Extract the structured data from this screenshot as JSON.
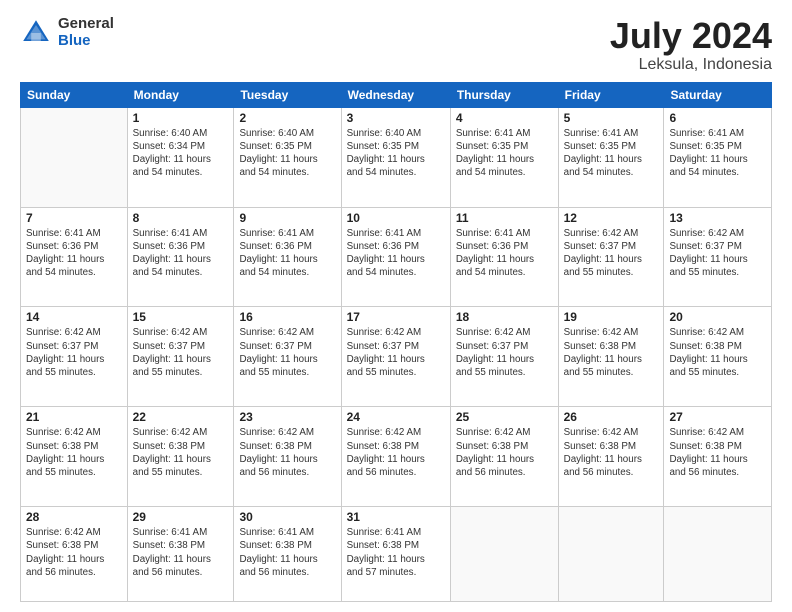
{
  "logo": {
    "general": "General",
    "blue": "Blue"
  },
  "title": {
    "month": "July 2024",
    "location": "Leksula, Indonesia"
  },
  "headers": [
    "Sunday",
    "Monday",
    "Tuesday",
    "Wednesday",
    "Thursday",
    "Friday",
    "Saturday"
  ],
  "weeks": [
    [
      {
        "day": "",
        "info": ""
      },
      {
        "day": "1",
        "info": "Sunrise: 6:40 AM\nSunset: 6:34 PM\nDaylight: 11 hours\nand 54 minutes."
      },
      {
        "day": "2",
        "info": "Sunrise: 6:40 AM\nSunset: 6:35 PM\nDaylight: 11 hours\nand 54 minutes."
      },
      {
        "day": "3",
        "info": "Sunrise: 6:40 AM\nSunset: 6:35 PM\nDaylight: 11 hours\nand 54 minutes."
      },
      {
        "day": "4",
        "info": "Sunrise: 6:41 AM\nSunset: 6:35 PM\nDaylight: 11 hours\nand 54 minutes."
      },
      {
        "day": "5",
        "info": "Sunrise: 6:41 AM\nSunset: 6:35 PM\nDaylight: 11 hours\nand 54 minutes."
      },
      {
        "day": "6",
        "info": "Sunrise: 6:41 AM\nSunset: 6:35 PM\nDaylight: 11 hours\nand 54 minutes."
      }
    ],
    [
      {
        "day": "7",
        "info": "Sunrise: 6:41 AM\nSunset: 6:36 PM\nDaylight: 11 hours\nand 54 minutes."
      },
      {
        "day": "8",
        "info": "Sunrise: 6:41 AM\nSunset: 6:36 PM\nDaylight: 11 hours\nand 54 minutes."
      },
      {
        "day": "9",
        "info": "Sunrise: 6:41 AM\nSunset: 6:36 PM\nDaylight: 11 hours\nand 54 minutes."
      },
      {
        "day": "10",
        "info": "Sunrise: 6:41 AM\nSunset: 6:36 PM\nDaylight: 11 hours\nand 54 minutes."
      },
      {
        "day": "11",
        "info": "Sunrise: 6:41 AM\nSunset: 6:36 PM\nDaylight: 11 hours\nand 54 minutes."
      },
      {
        "day": "12",
        "info": "Sunrise: 6:42 AM\nSunset: 6:37 PM\nDaylight: 11 hours\nand 55 minutes."
      },
      {
        "day": "13",
        "info": "Sunrise: 6:42 AM\nSunset: 6:37 PM\nDaylight: 11 hours\nand 55 minutes."
      }
    ],
    [
      {
        "day": "14",
        "info": "Sunrise: 6:42 AM\nSunset: 6:37 PM\nDaylight: 11 hours\nand 55 minutes."
      },
      {
        "day": "15",
        "info": "Sunrise: 6:42 AM\nSunset: 6:37 PM\nDaylight: 11 hours\nand 55 minutes."
      },
      {
        "day": "16",
        "info": "Sunrise: 6:42 AM\nSunset: 6:37 PM\nDaylight: 11 hours\nand 55 minutes."
      },
      {
        "day": "17",
        "info": "Sunrise: 6:42 AM\nSunset: 6:37 PM\nDaylight: 11 hours\nand 55 minutes."
      },
      {
        "day": "18",
        "info": "Sunrise: 6:42 AM\nSunset: 6:37 PM\nDaylight: 11 hours\nand 55 minutes."
      },
      {
        "day": "19",
        "info": "Sunrise: 6:42 AM\nSunset: 6:38 PM\nDaylight: 11 hours\nand 55 minutes."
      },
      {
        "day": "20",
        "info": "Sunrise: 6:42 AM\nSunset: 6:38 PM\nDaylight: 11 hours\nand 55 minutes."
      }
    ],
    [
      {
        "day": "21",
        "info": "Sunrise: 6:42 AM\nSunset: 6:38 PM\nDaylight: 11 hours\nand 55 minutes."
      },
      {
        "day": "22",
        "info": "Sunrise: 6:42 AM\nSunset: 6:38 PM\nDaylight: 11 hours\nand 55 minutes."
      },
      {
        "day": "23",
        "info": "Sunrise: 6:42 AM\nSunset: 6:38 PM\nDaylight: 11 hours\nand 56 minutes."
      },
      {
        "day": "24",
        "info": "Sunrise: 6:42 AM\nSunset: 6:38 PM\nDaylight: 11 hours\nand 56 minutes."
      },
      {
        "day": "25",
        "info": "Sunrise: 6:42 AM\nSunset: 6:38 PM\nDaylight: 11 hours\nand 56 minutes."
      },
      {
        "day": "26",
        "info": "Sunrise: 6:42 AM\nSunset: 6:38 PM\nDaylight: 11 hours\nand 56 minutes."
      },
      {
        "day": "27",
        "info": "Sunrise: 6:42 AM\nSunset: 6:38 PM\nDaylight: 11 hours\nand 56 minutes."
      }
    ],
    [
      {
        "day": "28",
        "info": "Sunrise: 6:42 AM\nSunset: 6:38 PM\nDaylight: 11 hours\nand 56 minutes."
      },
      {
        "day": "29",
        "info": "Sunrise: 6:41 AM\nSunset: 6:38 PM\nDaylight: 11 hours\nand 56 minutes."
      },
      {
        "day": "30",
        "info": "Sunrise: 6:41 AM\nSunset: 6:38 PM\nDaylight: 11 hours\nand 56 minutes."
      },
      {
        "day": "31",
        "info": "Sunrise: 6:41 AM\nSunset: 6:38 PM\nDaylight: 11 hours\nand 57 minutes."
      },
      {
        "day": "",
        "info": ""
      },
      {
        "day": "",
        "info": ""
      },
      {
        "day": "",
        "info": ""
      }
    ]
  ]
}
